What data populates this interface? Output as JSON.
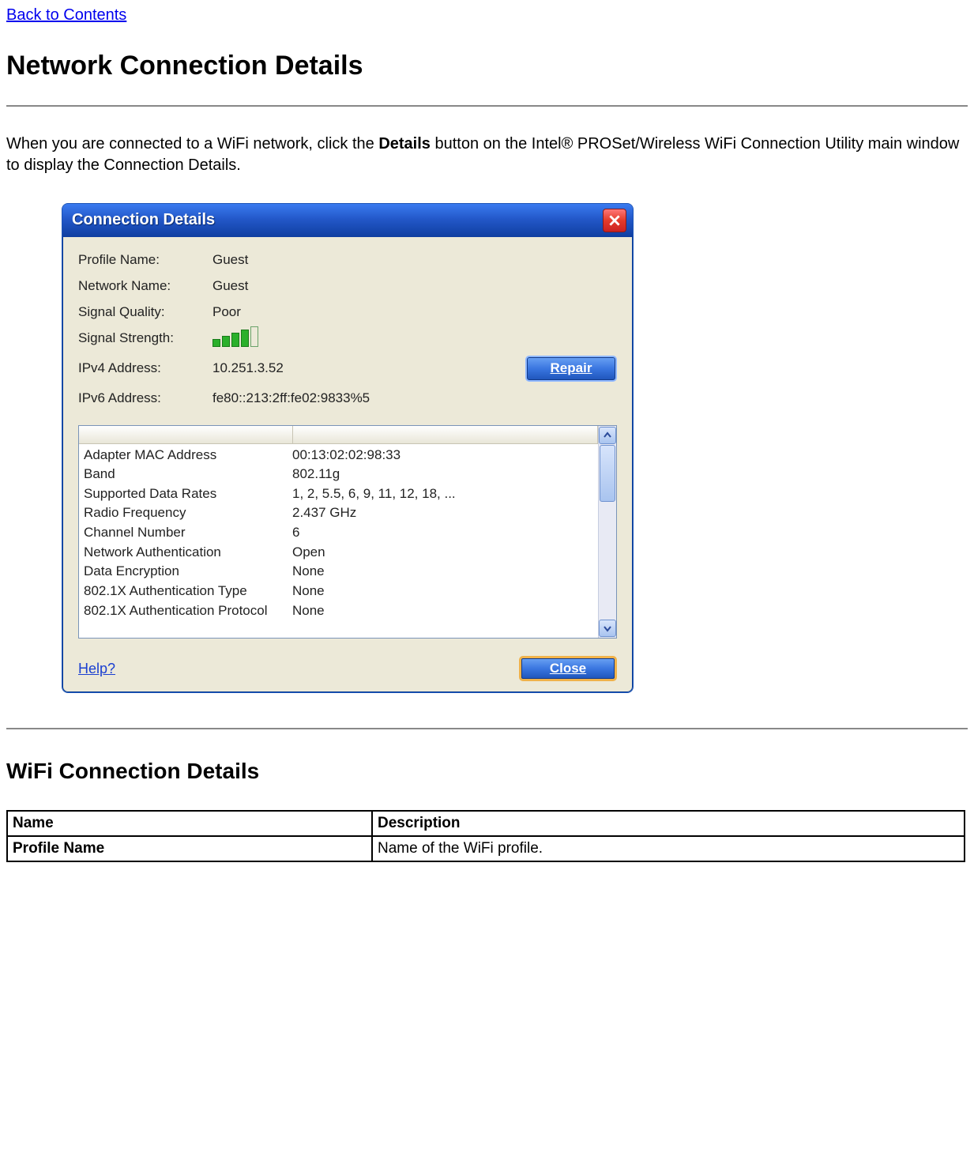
{
  "nav": {
    "back_link": "Back to Contents"
  },
  "page": {
    "title": "Network Connection Details",
    "intro_part1": "When you are connected to a WiFi network, click the ",
    "intro_bold": "Details",
    "intro_part2": " button on the Intel® PROSet/Wireless WiFi Connection Utility main window to display the Connection Details."
  },
  "dialog": {
    "title": "Connection Details",
    "fields": {
      "profile_name_label": "Profile Name:",
      "profile_name_value": "Guest",
      "network_name_label": "Network Name:",
      "network_name_value": "Guest",
      "signal_quality_label": "Signal Quality:",
      "signal_quality_value": "Poor",
      "signal_strength_label": "Signal Strength:",
      "ipv4_label": "IPv4 Address:",
      "ipv4_value": "10.251.3.52",
      "ipv6_label": "IPv6 Address:",
      "ipv6_value": "fe80::213:2ff:fe02:9833%5"
    },
    "repair_button": "Repair",
    "list": [
      {
        "name": "Adapter MAC Address",
        "value": "00:13:02:02:98:33"
      },
      {
        "name": "Band",
        "value": "802.11g"
      },
      {
        "name": "Supported Data Rates",
        "value": "1, 2, 5.5, 6, 9, 11, 12, 18, ..."
      },
      {
        "name": "Radio Frequency",
        "value": "2.437 GHz"
      },
      {
        "name": "Channel Number",
        "value": "6"
      },
      {
        "name": "Network Authentication",
        "value": "Open"
      },
      {
        "name": "Data Encryption",
        "value": "None"
      },
      {
        "name": "802.1X Authentication Type",
        "value": "None"
      },
      {
        "name": "802.1X Authentication Protocol",
        "value": "None"
      }
    ],
    "help_link": "Help?",
    "close_button": "Close"
  },
  "section2": {
    "title": "WiFi Connection Details",
    "table_headers": {
      "name": "Name",
      "description": "Description"
    },
    "rows": [
      {
        "name": "Profile Name",
        "description": "Name of the WiFi profile."
      }
    ]
  }
}
